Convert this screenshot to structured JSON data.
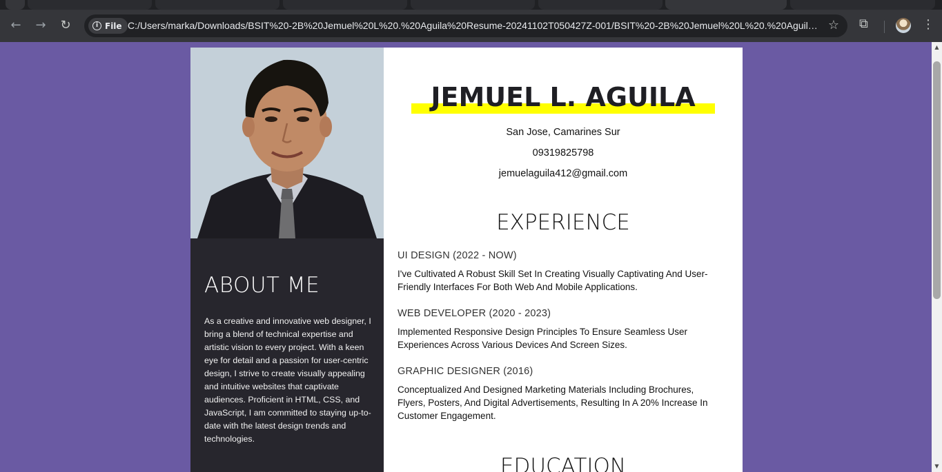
{
  "browser": {
    "url": "C:/Users/marka/Downloads/BSIT%20-2B%20Jemuel%20L%20.%20Aguila%20Resume-20241102T050427Z-001/BSIT%20-2B%20Jemuel%20L%20.%20Aguila%20...",
    "site_chip_label": "File",
    "back_icon": "←",
    "forward_icon": "→",
    "reload_icon": "↻",
    "star_icon": "☆",
    "extensions_icon": "⧉",
    "menu_icon": "⋮"
  },
  "resume": {
    "name": "JEMUEL L. AGUILA",
    "contact": {
      "address": "San Jose, Camarines Sur",
      "phone": "09319825798",
      "email": "jemuelaguila412@gmail.com"
    },
    "about": {
      "title": "ABOUT ME",
      "text": "As a creative and innovative web designer, I bring a blend of technical expertise and artistic vision to every project. With a keen eye for detail and a passion for user-centric design, I strive to create visually appealing and intuitive websites that captivate audiences. Proficient in HTML, CSS, and JavaScript, I am committed to staying up-to-date with the latest design trends and technologies."
    },
    "experience": {
      "title": "EXPERIENCE",
      "items": [
        {
          "title": "UI DESIGN (2022 - NOW)",
          "desc": "I've Cultivated A Robust Skill Set In Creating Visually Captivating And User-Friendly Interfaces For Both Web And Mobile Applications."
        },
        {
          "title": "WEB DEVELOPER (2020 - 2023)",
          "desc": "Implemented Responsive Design Principles To Ensure Seamless User Experiences Across Various Devices And Screen Sizes."
        },
        {
          "title": "GRAPHIC DESIGNER (2016)",
          "desc": "Conceptualized And Designed Marketing Materials Including Brochures, Flyers, Posters, And Digital Advertisements, Resulting In A 20% Increase In Customer Engagement."
        }
      ]
    },
    "education": {
      "title": "EDUCATION"
    }
  },
  "colors": {
    "page_background": "#6a5aa3",
    "sidebar": "#27262d",
    "name_highlight": "#ffff00"
  }
}
